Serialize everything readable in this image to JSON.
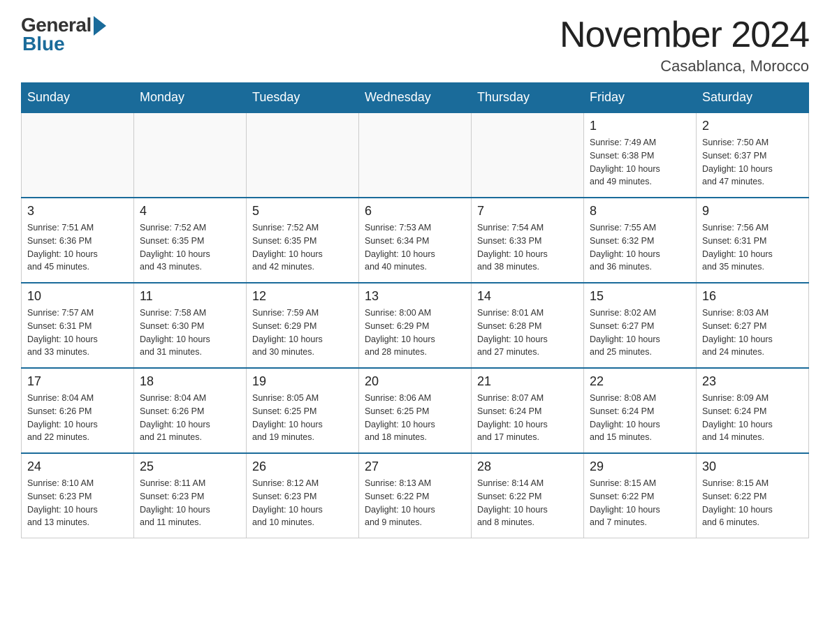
{
  "logo": {
    "general": "General",
    "blue": "Blue"
  },
  "title": "November 2024",
  "location": "Casablanca, Morocco",
  "days_of_week": [
    "Sunday",
    "Monday",
    "Tuesday",
    "Wednesday",
    "Thursday",
    "Friday",
    "Saturday"
  ],
  "weeks": [
    {
      "days": [
        {
          "number": "",
          "info": ""
        },
        {
          "number": "",
          "info": ""
        },
        {
          "number": "",
          "info": ""
        },
        {
          "number": "",
          "info": ""
        },
        {
          "number": "",
          "info": ""
        },
        {
          "number": "1",
          "info": "Sunrise: 7:49 AM\nSunset: 6:38 PM\nDaylight: 10 hours\nand 49 minutes."
        },
        {
          "number": "2",
          "info": "Sunrise: 7:50 AM\nSunset: 6:37 PM\nDaylight: 10 hours\nand 47 minutes."
        }
      ]
    },
    {
      "days": [
        {
          "number": "3",
          "info": "Sunrise: 7:51 AM\nSunset: 6:36 PM\nDaylight: 10 hours\nand 45 minutes."
        },
        {
          "number": "4",
          "info": "Sunrise: 7:52 AM\nSunset: 6:35 PM\nDaylight: 10 hours\nand 43 minutes."
        },
        {
          "number": "5",
          "info": "Sunrise: 7:52 AM\nSunset: 6:35 PM\nDaylight: 10 hours\nand 42 minutes."
        },
        {
          "number": "6",
          "info": "Sunrise: 7:53 AM\nSunset: 6:34 PM\nDaylight: 10 hours\nand 40 minutes."
        },
        {
          "number": "7",
          "info": "Sunrise: 7:54 AM\nSunset: 6:33 PM\nDaylight: 10 hours\nand 38 minutes."
        },
        {
          "number": "8",
          "info": "Sunrise: 7:55 AM\nSunset: 6:32 PM\nDaylight: 10 hours\nand 36 minutes."
        },
        {
          "number": "9",
          "info": "Sunrise: 7:56 AM\nSunset: 6:31 PM\nDaylight: 10 hours\nand 35 minutes."
        }
      ]
    },
    {
      "days": [
        {
          "number": "10",
          "info": "Sunrise: 7:57 AM\nSunset: 6:31 PM\nDaylight: 10 hours\nand 33 minutes."
        },
        {
          "number": "11",
          "info": "Sunrise: 7:58 AM\nSunset: 6:30 PM\nDaylight: 10 hours\nand 31 minutes."
        },
        {
          "number": "12",
          "info": "Sunrise: 7:59 AM\nSunset: 6:29 PM\nDaylight: 10 hours\nand 30 minutes."
        },
        {
          "number": "13",
          "info": "Sunrise: 8:00 AM\nSunset: 6:29 PM\nDaylight: 10 hours\nand 28 minutes."
        },
        {
          "number": "14",
          "info": "Sunrise: 8:01 AM\nSunset: 6:28 PM\nDaylight: 10 hours\nand 27 minutes."
        },
        {
          "number": "15",
          "info": "Sunrise: 8:02 AM\nSunset: 6:27 PM\nDaylight: 10 hours\nand 25 minutes."
        },
        {
          "number": "16",
          "info": "Sunrise: 8:03 AM\nSunset: 6:27 PM\nDaylight: 10 hours\nand 24 minutes."
        }
      ]
    },
    {
      "days": [
        {
          "number": "17",
          "info": "Sunrise: 8:04 AM\nSunset: 6:26 PM\nDaylight: 10 hours\nand 22 minutes."
        },
        {
          "number": "18",
          "info": "Sunrise: 8:04 AM\nSunset: 6:26 PM\nDaylight: 10 hours\nand 21 minutes."
        },
        {
          "number": "19",
          "info": "Sunrise: 8:05 AM\nSunset: 6:25 PM\nDaylight: 10 hours\nand 19 minutes."
        },
        {
          "number": "20",
          "info": "Sunrise: 8:06 AM\nSunset: 6:25 PM\nDaylight: 10 hours\nand 18 minutes."
        },
        {
          "number": "21",
          "info": "Sunrise: 8:07 AM\nSunset: 6:24 PM\nDaylight: 10 hours\nand 17 minutes."
        },
        {
          "number": "22",
          "info": "Sunrise: 8:08 AM\nSunset: 6:24 PM\nDaylight: 10 hours\nand 15 minutes."
        },
        {
          "number": "23",
          "info": "Sunrise: 8:09 AM\nSunset: 6:24 PM\nDaylight: 10 hours\nand 14 minutes."
        }
      ]
    },
    {
      "days": [
        {
          "number": "24",
          "info": "Sunrise: 8:10 AM\nSunset: 6:23 PM\nDaylight: 10 hours\nand 13 minutes."
        },
        {
          "number": "25",
          "info": "Sunrise: 8:11 AM\nSunset: 6:23 PM\nDaylight: 10 hours\nand 11 minutes."
        },
        {
          "number": "26",
          "info": "Sunrise: 8:12 AM\nSunset: 6:23 PM\nDaylight: 10 hours\nand 10 minutes."
        },
        {
          "number": "27",
          "info": "Sunrise: 8:13 AM\nSunset: 6:22 PM\nDaylight: 10 hours\nand 9 minutes."
        },
        {
          "number": "28",
          "info": "Sunrise: 8:14 AM\nSunset: 6:22 PM\nDaylight: 10 hours\nand 8 minutes."
        },
        {
          "number": "29",
          "info": "Sunrise: 8:15 AM\nSunset: 6:22 PM\nDaylight: 10 hours\nand 7 minutes."
        },
        {
          "number": "30",
          "info": "Sunrise: 8:15 AM\nSunset: 6:22 PM\nDaylight: 10 hours\nand 6 minutes."
        }
      ]
    }
  ]
}
